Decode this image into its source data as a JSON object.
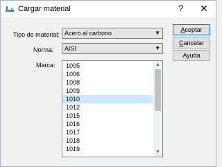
{
  "window": {
    "title": "Cargar material",
    "help_glyph": "?",
    "close_glyph": "✕",
    "app_icon": "caliper-icon"
  },
  "form": {
    "material_type": {
      "label": "Tipo de material:",
      "value": "Acero al carbono"
    },
    "standard": {
      "label": "Norma:",
      "value": "AISI"
    },
    "grade": {
      "label": "Marca:",
      "items": [
        "1005",
        "1006",
        "1008",
        "1009",
        "1010",
        "1012",
        "1015",
        "1016",
        "1017",
        "1018",
        "1019"
      ],
      "selected": "1010"
    }
  },
  "buttons": {
    "accept": {
      "accel": "A",
      "rest": "ceptar"
    },
    "cancel": {
      "accel": "C",
      "rest": "ancelar"
    },
    "help": {
      "label": "Ayuda"
    }
  },
  "icons": {
    "dropdown": "▼",
    "scroll_up": "▲",
    "scroll_down": "▼"
  }
}
